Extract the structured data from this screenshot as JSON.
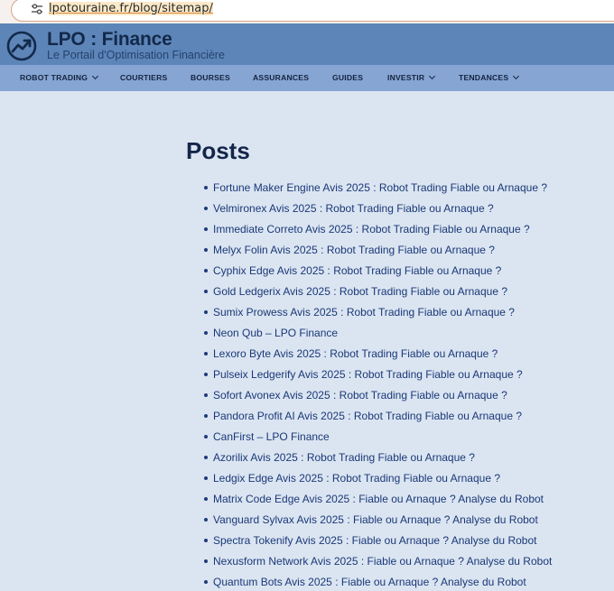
{
  "browser": {
    "url": "lpotouraine.fr/blog/sitemap/"
  },
  "site": {
    "title": "LPO : Finance",
    "tagline": "Le Portail d'Optimisation Financière"
  },
  "nav": {
    "items": [
      {
        "label": "ROBOT TRADING",
        "has_dropdown": true
      },
      {
        "label": "COURTIERS",
        "has_dropdown": false
      },
      {
        "label": "BOURSES",
        "has_dropdown": false
      },
      {
        "label": "ASSURANCES",
        "has_dropdown": false
      },
      {
        "label": "GUIDES",
        "has_dropdown": false
      },
      {
        "label": "INVESTIR",
        "has_dropdown": true
      },
      {
        "label": "TENDANCES",
        "has_dropdown": true
      }
    ]
  },
  "main": {
    "heading": "Posts",
    "posts": [
      "Fortune Maker Engine Avis 2025 : Robot Trading Fiable ou Arnaque ?",
      "Velmironex Avis 2025 : Robot Trading Fiable ou Arnaque ?",
      "Immediate Correto Avis 2025 : Robot Trading Fiable ou Arnaque ?",
      "Melyx Folin Avis 2025 : Robot Trading Fiable ou Arnaque ?",
      "Cyphix Edge Avis 2025 : Robot Trading Fiable ou Arnaque ?",
      "Gold Ledgerix Avis 2025 : Robot Trading Fiable ou Arnaque ?",
      "Sumix Prowess Avis 2025 : Robot Trading Fiable ou Arnaque ?",
      "Neon Qub – LPO Finance",
      "Lexoro Byte Avis 2025 : Robot Trading Fiable ou Arnaque ?",
      "Pulseix Ledgerify Avis 2025 : Robot Trading Fiable ou Arnaque ?",
      "Sofort Avonex Avis 2025 : Robot Trading Fiable ou Arnaque ?",
      "Pandora Profit AI Avis 2025 : Robot Trading Fiable ou Arnaque ?",
      "CanFirst – LPO Finance",
      "Azorilix Avis 2025 : Robot Trading Fiable ou Arnaque ?",
      "Ledgix Edge Avis 2025 : Robot Trading Fiable ou Arnaque ?",
      "Matrix Code Edge Avis 2025 : Fiable ou Arnaque ? Analyse du Robot",
      "Vanguard Sylvax Avis 2025 : Fiable ou Arnaque ? Analyse du Robot",
      "Spectra Tokenify Avis 2025 : Fiable ou Arnaque ? Analyse du Robot",
      "Nexusform Network Avis 2025 : Fiable ou Arnaque ? Analyse du Robot",
      "Quantum Bots Avis 2025 : Fiable ou Arnaque ? Analyse du Robot"
    ]
  },
  "colors": {
    "page_bg": "#dbe5f1",
    "header_bg": "#5d85b8",
    "nav_bg": "#86a5d3",
    "link": "#1a3878",
    "heading": "#14264a"
  }
}
